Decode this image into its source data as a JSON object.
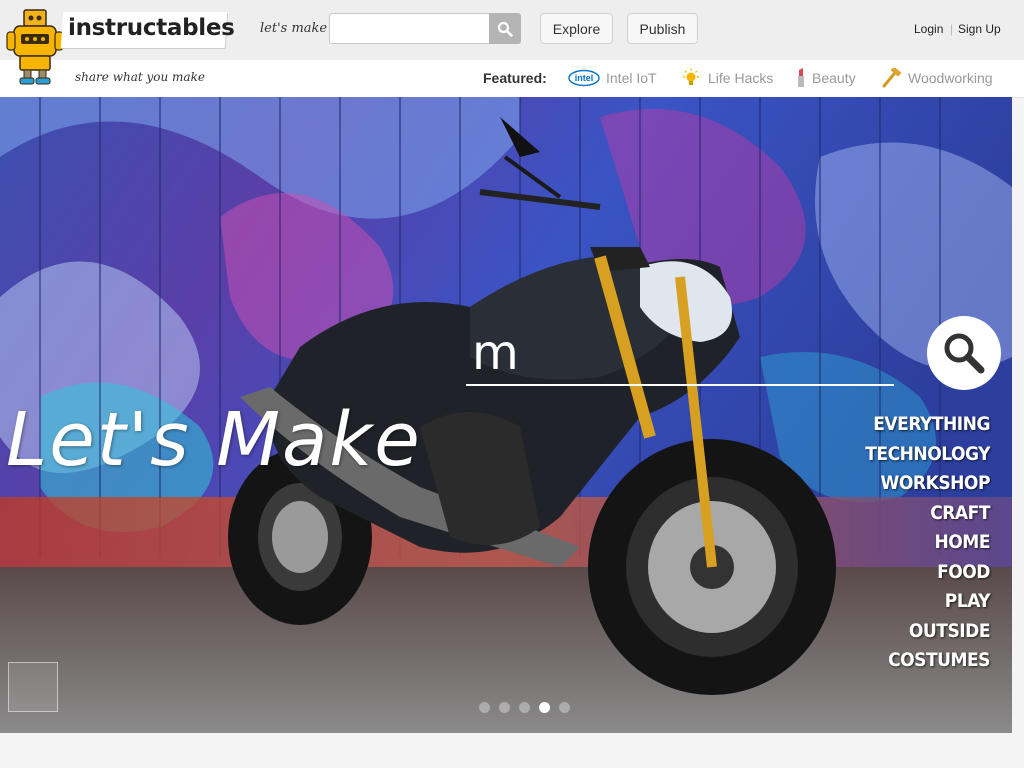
{
  "header": {
    "logo_text": "instructables",
    "tagline": "share what you make",
    "letsmake_label": "let's make",
    "search_placeholder": "",
    "explore_label": "Explore",
    "publish_label": "Publish",
    "login_label": "Login",
    "separator": "|",
    "signup_label": "Sign Up"
  },
  "featured": {
    "label": "Featured:",
    "items": [
      {
        "label": "Intel IoT",
        "icon": "intel-icon"
      },
      {
        "label": "Life Hacks",
        "icon": "lightbulb-icon"
      },
      {
        "label": "Beauty",
        "icon": "lipstick-icon"
      },
      {
        "label": "Woodworking",
        "icon": "hammer-icon"
      }
    ]
  },
  "hero": {
    "title": "Let's Make",
    "search_value": "m",
    "categories": [
      "EVERYTHING",
      "TECHNOLOGY",
      "WORKSHOP",
      "CRAFT",
      "HOME",
      "FOOD",
      "PLAY",
      "OUTSIDE",
      "COSTUMES"
    ],
    "slide_count": 5,
    "active_slide": 4
  },
  "colors": {
    "accent": "#f7b500",
    "topbar": "#eeeeee",
    "search_button": "#b4b4b4"
  }
}
